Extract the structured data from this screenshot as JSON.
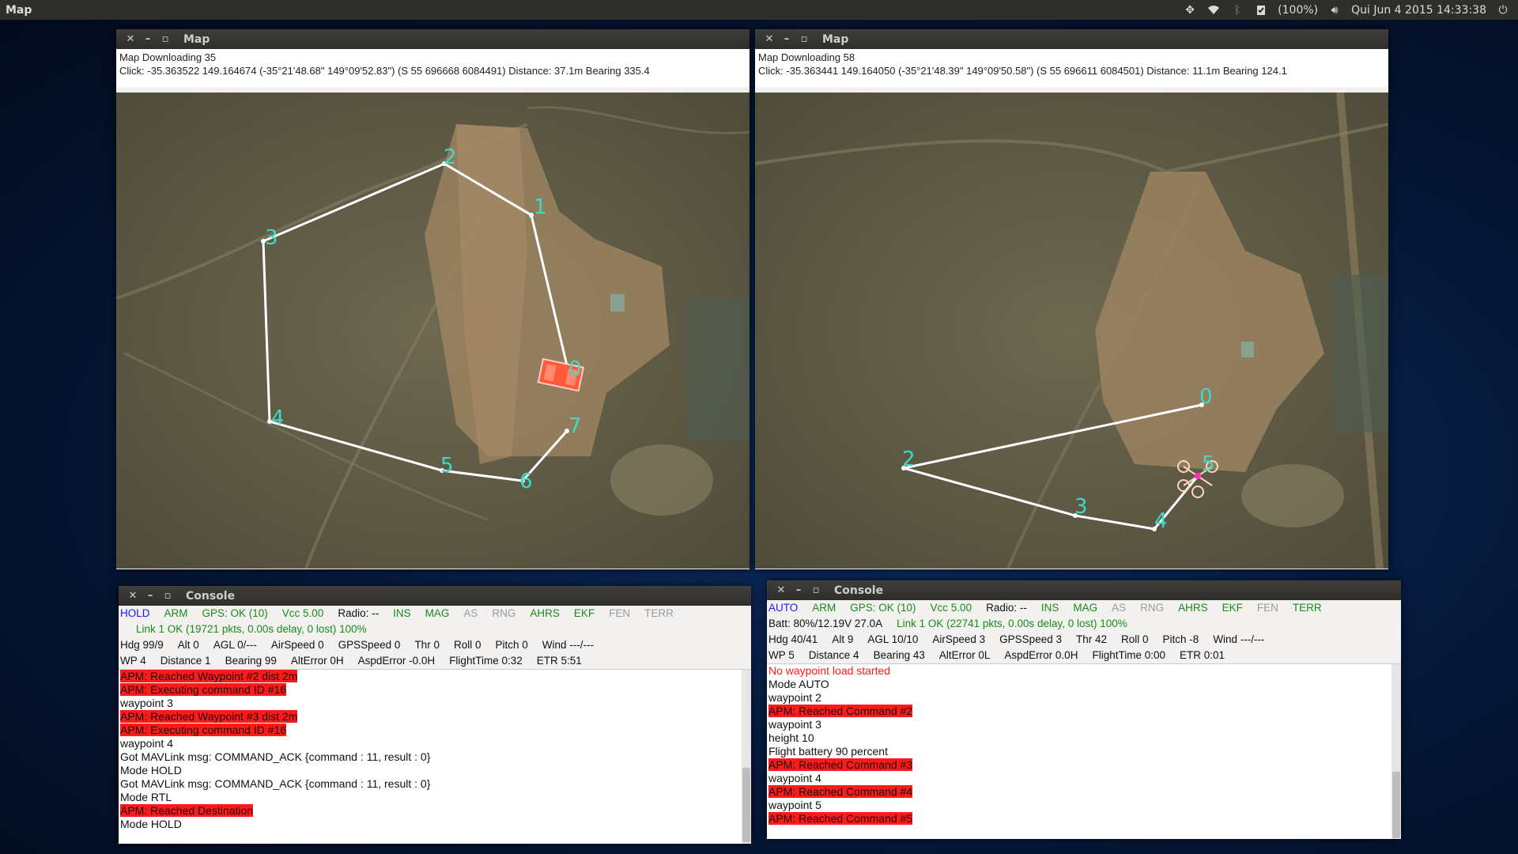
{
  "desktop": {
    "app_title": "Map",
    "indicators": {
      "battery": "(100%)",
      "clock": "Qui Jun 4 2015 14:33:38"
    }
  },
  "map_left": {
    "title": "Map",
    "info_line1": "Map Downloading 35",
    "info_line2": "Click: -35.363522 149.164674 (-35°21'48.68\" 149°09'52.83\") (S 55 696668 6084491)  Distance: 37.1m Bearing 335.4",
    "waypoint_labels": [
      "0",
      "1",
      "2",
      "3",
      "4",
      "5",
      "6",
      "7"
    ]
  },
  "map_right": {
    "title": "Map",
    "info_line1": "Map Downloading 58",
    "info_line2": "Click: -35.363441 149.164050 (-35°21'48.39\" 149°09'50.58\") (S 55 696611 6084501)  Distance: 11.1m Bearing 124.1",
    "waypoint_labels": [
      "0",
      "2",
      "3",
      "4",
      "5"
    ]
  },
  "console_left": {
    "title": "Console",
    "row1": [
      {
        "text": "HOLD",
        "color": "blue"
      },
      {
        "text": "ARM",
        "color": "green"
      },
      {
        "text": "GPS: OK (10)",
        "color": "green"
      },
      {
        "text": "Vcc 5.00",
        "color": "green"
      },
      {
        "text": "Radio: --",
        "color": "black"
      },
      {
        "text": "INS",
        "color": "green"
      },
      {
        "text": "MAG",
        "color": "green"
      },
      {
        "text": "AS",
        "color": "grey"
      },
      {
        "text": "RNG",
        "color": "grey"
      },
      {
        "text": "AHRS",
        "color": "green"
      },
      {
        "text": "EKF",
        "color": "green"
      },
      {
        "text": "FEN",
        "color": "grey"
      },
      {
        "text": "TERR",
        "color": "grey"
      }
    ],
    "link": "Link 1 OK (19721 pkts, 0.00s delay, 0 lost) 100%",
    "row3": [
      "Hdg 99/9",
      "Alt 0",
      "AGL 0/---",
      "AirSpeed 0",
      "GPSSpeed 0",
      "Thr 0",
      "Roll 0",
      "Pitch 0",
      "Wind ---/---"
    ],
    "row4": [
      "WP 4",
      "Distance 1",
      "Bearing 99",
      "AltError 0H",
      "AspdError -0.0H",
      "FlightTime 0:32",
      "ETR 5:51"
    ],
    "log": [
      {
        "text": "APM: Reached Waypoint #2 dist 2m",
        "style": "hl"
      },
      {
        "text": "APM: Executing command ID #16",
        "style": "hl"
      },
      {
        "text": "waypoint 3",
        "style": "plain"
      },
      {
        "text": "APM: Reached Waypoint #3 dist 2m",
        "style": "hl"
      },
      {
        "text": "APM: Executing command ID #16",
        "style": "hl"
      },
      {
        "text": "waypoint 4",
        "style": "plain"
      },
      {
        "text": "Got MAVLink msg: COMMAND_ACK {command : 11, result : 0}",
        "style": "plain"
      },
      {
        "text": "Mode HOLD",
        "style": "plain"
      },
      {
        "text": "Got MAVLink msg: COMMAND_ACK {command : 11, result : 0}",
        "style": "plain"
      },
      {
        "text": "Mode RTL",
        "style": "plain"
      },
      {
        "text": "APM: Reached Destination",
        "style": "hl"
      },
      {
        "text": "Mode HOLD",
        "style": "plain"
      }
    ]
  },
  "console_right": {
    "title": "Console",
    "row1": [
      {
        "text": "AUTO",
        "color": "blue"
      },
      {
        "text": "ARM",
        "color": "green"
      },
      {
        "text": "GPS: OK (10)",
        "color": "green"
      },
      {
        "text": "Vcc 5.00",
        "color": "green"
      },
      {
        "text": "Radio: --",
        "color": "black"
      },
      {
        "text": "INS",
        "color": "green"
      },
      {
        "text": "MAG",
        "color": "green"
      },
      {
        "text": "AS",
        "color": "grey"
      },
      {
        "text": "RNG",
        "color": "grey"
      },
      {
        "text": "AHRS",
        "color": "green"
      },
      {
        "text": "EKF",
        "color": "green"
      },
      {
        "text": "FEN",
        "color": "grey"
      },
      {
        "text": "TERR",
        "color": "green"
      }
    ],
    "batt": "Batt: 80%/12.19V 27.0A",
    "link": "Link 1 OK (22741 pkts, 0.00s delay, 0 lost) 100%",
    "row3": [
      "Hdg 40/41",
      "Alt 9",
      "AGL 10/10",
      "AirSpeed 3",
      "GPSSpeed 3",
      "Thr 42",
      "Roll 0",
      "Pitch -8",
      "Wind ---/---"
    ],
    "row4": [
      "WP 5",
      "Distance 4",
      "Bearing 43",
      "AltError 0L",
      "AspdError 0.0H",
      "FlightTime 0:00",
      "ETR 0:01"
    ],
    "log": [
      {
        "text": "No waypoint load started",
        "style": "red"
      },
      {
        "text": "Mode AUTO",
        "style": "plain"
      },
      {
        "text": "waypoint 2",
        "style": "plain"
      },
      {
        "text": "APM: Reached Command #2",
        "style": "hl"
      },
      {
        "text": "waypoint 3",
        "style": "plain"
      },
      {
        "text": "height 10",
        "style": "plain"
      },
      {
        "text": "Flight battery 90 percent",
        "style": "plain"
      },
      {
        "text": "APM: Reached Command #3",
        "style": "hl"
      },
      {
        "text": "waypoint 4",
        "style": "plain"
      },
      {
        "text": "APM: Reached Command #4",
        "style": "hl"
      },
      {
        "text": "waypoint 5",
        "style": "plain"
      },
      {
        "text": "APM: Reached Command #5",
        "style": "hl"
      }
    ]
  },
  "colors": {
    "highlight_red": "#ff1a1a",
    "waypoint_label": "#3fd9c9",
    "route_line": "#ffffff",
    "status_green": "#1a8a1a",
    "status_blue": "#1a1aff"
  },
  "icons": [
    "dropbox-icon",
    "wifi-icon",
    "bluetooth-icon",
    "clipboard-icon",
    "volume-icon",
    "power-icon"
  ]
}
